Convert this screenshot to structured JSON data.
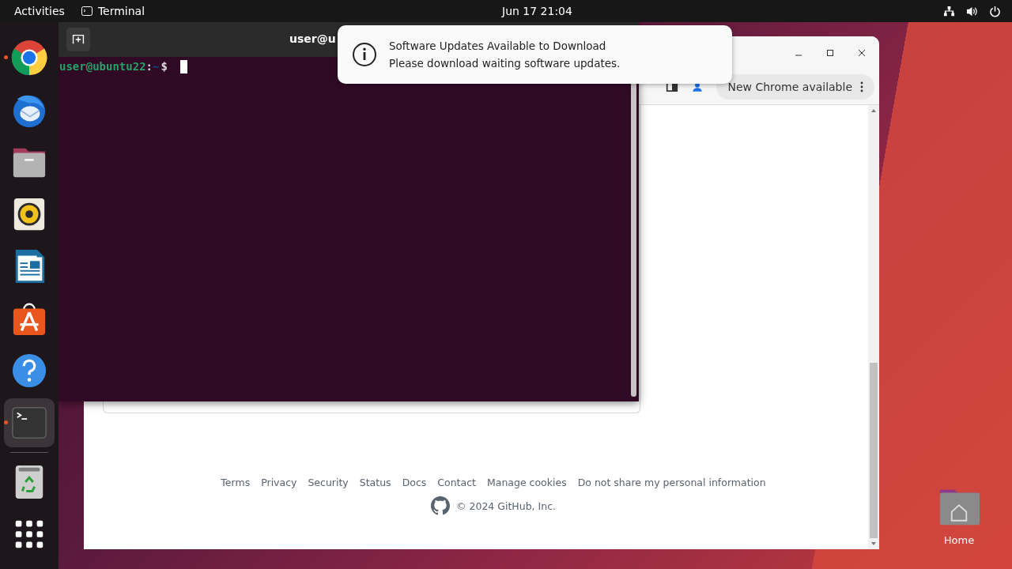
{
  "top_bar": {
    "activities": "Activities",
    "app_menu": "Terminal",
    "clock": "Jun 17  21:04"
  },
  "dock": [
    {
      "kind": "chrome",
      "running": true,
      "selected": false
    },
    {
      "kind": "thunderbird",
      "running": false,
      "selected": false
    },
    {
      "kind": "files",
      "running": false,
      "selected": false
    },
    {
      "kind": "rhythmbox",
      "running": false,
      "selected": false
    },
    {
      "kind": "writer",
      "running": false,
      "selected": false
    },
    {
      "kind": "software",
      "running": false,
      "selected": false
    },
    {
      "kind": "help",
      "running": false,
      "selected": false
    },
    {
      "kind": "terminal",
      "running": true,
      "selected": true
    },
    {
      "kind": "trash",
      "running": false,
      "selected": false
    },
    {
      "kind": "apps",
      "running": false,
      "selected": false
    }
  ],
  "browser": {
    "update_button": "New Chrome available",
    "footer_links": [
      "Terms",
      "Privacy",
      "Security",
      "Status",
      "Docs",
      "Contact",
      "Manage cookies",
      "Do not share my personal information"
    ],
    "copyright": "© 2024 GitHub, Inc."
  },
  "terminal": {
    "title": "user@u",
    "prompt_user": "user@ubuntu22",
    "prompt_sep": ":",
    "prompt_path": "~",
    "prompt_symbol": "$"
  },
  "notification": {
    "title": "Software Updates Available to Download",
    "body": "Please download waiting software updates."
  },
  "desktop_icons": [
    {
      "label": "Home"
    }
  ]
}
